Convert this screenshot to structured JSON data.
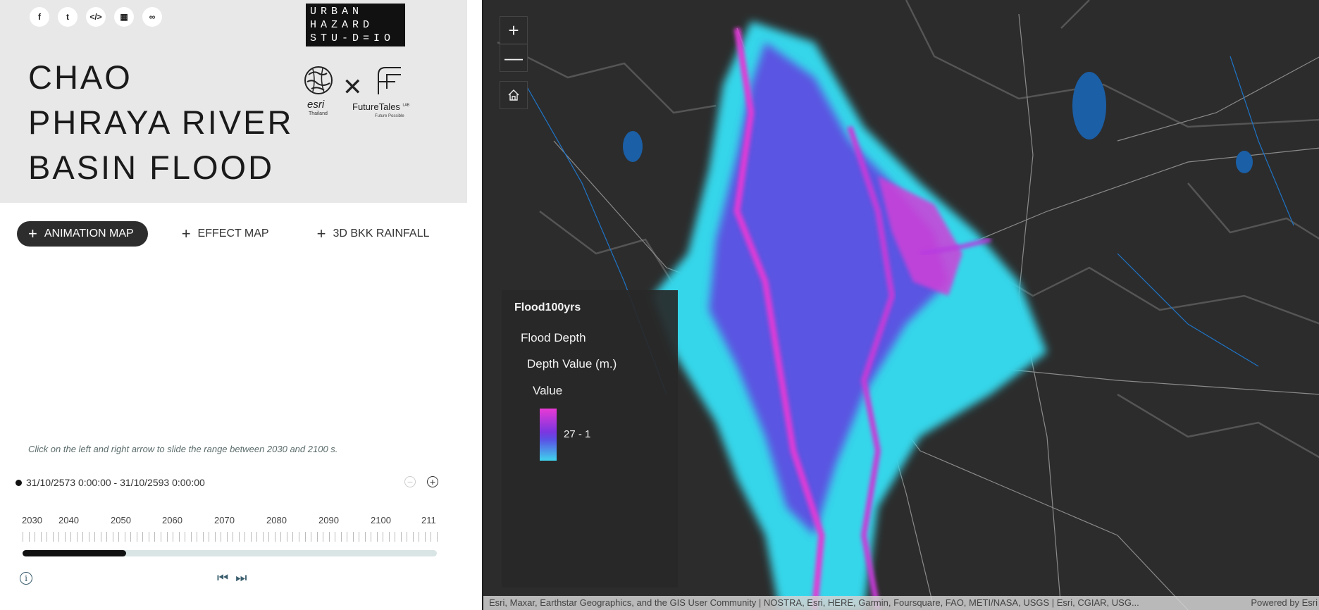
{
  "social": [
    {
      "icon": "facebook-icon",
      "glyph": "f"
    },
    {
      "icon": "twitter-icon",
      "glyph": "t"
    },
    {
      "icon": "embed-icon",
      "glyph": "</>"
    },
    {
      "icon": "qr-code-icon",
      "glyph": "▦"
    },
    {
      "icon": "link-icon",
      "glyph": "∞"
    }
  ],
  "header": {
    "title_lines": [
      "CHAO",
      "PHRAYA RIVER",
      "BASIN FLOOD"
    ],
    "brand_lines": [
      "URBAN",
      "HAZARD",
      "STU-D=IO"
    ],
    "esri_name": "esri",
    "esri_sub": "Thailand",
    "futuretales_name": "FutureTales",
    "futuretales_lab": "LAB",
    "futuretales_sub": "Future Possible"
  },
  "tabs": [
    {
      "label": "ANIMATION MAP",
      "active": true
    },
    {
      "label": "EFFECT MAP",
      "active": false
    },
    {
      "label": "3D BKK RAINFALL",
      "active": false
    }
  ],
  "timeline": {
    "hint": "Click on the left and right arrow to slide the range between 2030 and 2100 s.",
    "range": "31/10/2573 0:00:00 - 31/10/2593 0:00:00",
    "years": [
      "2030",
      "2040",
      "2050",
      "2060",
      "2070",
      "2080",
      "2090",
      "2100",
      "211"
    ],
    "progress": 0.25
  },
  "map": {
    "zoom_in": "+",
    "zoom_out": "—",
    "legend": {
      "layer": "Flood100yrs",
      "group": "Flood Depth",
      "field": "Depth Value (m.)",
      "value_label": "Value",
      "range_label": "27 - 1"
    },
    "attribution": "Esri, Maxar, Earthstar Geographics, and the GIS User Community | NOSTRA, Esri, HERE, Garmin, Foursquare, FAO, METI/NASA, USGS | Esri, CGIAR, USG...",
    "powered_by": "Powered by Esri"
  },
  "colors": {
    "flood_deep": "#e83ad4",
    "flood_mid": "#7a36e0",
    "flood_shallow": "#3fd3ec",
    "map_bg": "#2c2c2c"
  }
}
